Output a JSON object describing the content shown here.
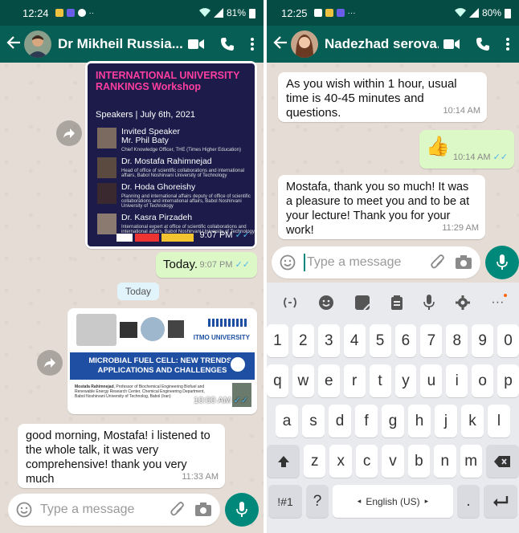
{
  "left": {
    "status": {
      "time": "12:24",
      "battery": "81%"
    },
    "contact": {
      "name": "Dr Mikheil Russia..."
    },
    "poster": {
      "title_line1": "INTERNATIONAL UNIVERSITY",
      "title_line2": "RANKINGS Workshop",
      "speakers_header": "Speakers | July 6th, 2021",
      "speakers": [
        {
          "name": "Invited Speaker",
          "name2": "Mr. Phil Baty",
          "sub": "Chief Knowledge Officer, THE (Times Higher Education)"
        },
        {
          "name": "Dr. Mostafa Rahimnejad",
          "name2": "",
          "sub": "Head of office of scientific collaborations and international affairs, Babol Noshirvani University of Technology"
        },
        {
          "name": "Dr. Hoda Ghoreishy",
          "name2": "",
          "sub": "Planning and international affairs deputy of office of scientific collaborations and international affairs, Babol Noshirvani University of Technology"
        },
        {
          "name": "Dr. Kasra Pirzadeh",
          "name2": "",
          "sub": "International expert at office of scientific collaborations and international affairs, Babol Noshirvani University of Technology"
        }
      ],
      "time": "9:07 PM"
    },
    "msg_today": {
      "text": "Today.",
      "time": "9:07 PM"
    },
    "date_chip": "Today",
    "itmo": {
      "logo_text": "ITMO UNIVERSITY",
      "title_line1": "MICROBIAL FUEL CELL: NEW TRENDS ,",
      "title_line2": "APPLICATIONS AND CHALLENGES",
      "author_bold": "Mostafa Rahimnejad",
      "author_desc": ", Professor of Biochemical Engineering Biofuel and Renewable Energy Research Center, Chemical Engineering Department, Babol Noshirvani University of Technolog, Babol (Iran)",
      "time": "10:00 AM"
    },
    "msg_morning": {
      "text": "good morning, Mostafa! i listened to the whole talk, it was very comprehensive! thank you very much",
      "time": "11:33 AM"
    },
    "input_placeholder": "Type a message"
  },
  "right": {
    "status": {
      "time": "12:25",
      "battery": "80%"
    },
    "contact": {
      "name": "Nadezhad serova..."
    },
    "msg1": {
      "text": "As you wish within 1 hour, usual time is 40-45 minutes and questions.",
      "time": "10:14 AM"
    },
    "msg2": {
      "emoji": "👍",
      "time": "10:14 AM"
    },
    "msg3": {
      "text": "Mostafa, thank you so much! It was a pleasure to meet you and to be at your lecture! Thank you for your work!",
      "time": "11:29 AM"
    },
    "input_placeholder": "Type a message",
    "keyboard": {
      "numbers": [
        "1",
        "2",
        "3",
        "4",
        "5",
        "6",
        "7",
        "8",
        "9",
        "0"
      ],
      "row1": [
        "q",
        "w",
        "e",
        "r",
        "t",
        "y",
        "u",
        "i",
        "o",
        "p"
      ],
      "row2": [
        "a",
        "s",
        "d",
        "f",
        "g",
        "h",
        "j",
        "k",
        "l"
      ],
      "row3": [
        "z",
        "x",
        "c",
        "v",
        "b",
        "n",
        "m"
      ],
      "sym_label": "!#1",
      "question": "?",
      "space_label": "English (US)",
      "period": "."
    }
  },
  "colors": {
    "header": "#075e54",
    "statusbar": "#054d44",
    "outgoing": "#dcf8c6",
    "incoming": "#ffffff",
    "accent": "#00897b",
    "read_tick": "#4fb6ec"
  }
}
